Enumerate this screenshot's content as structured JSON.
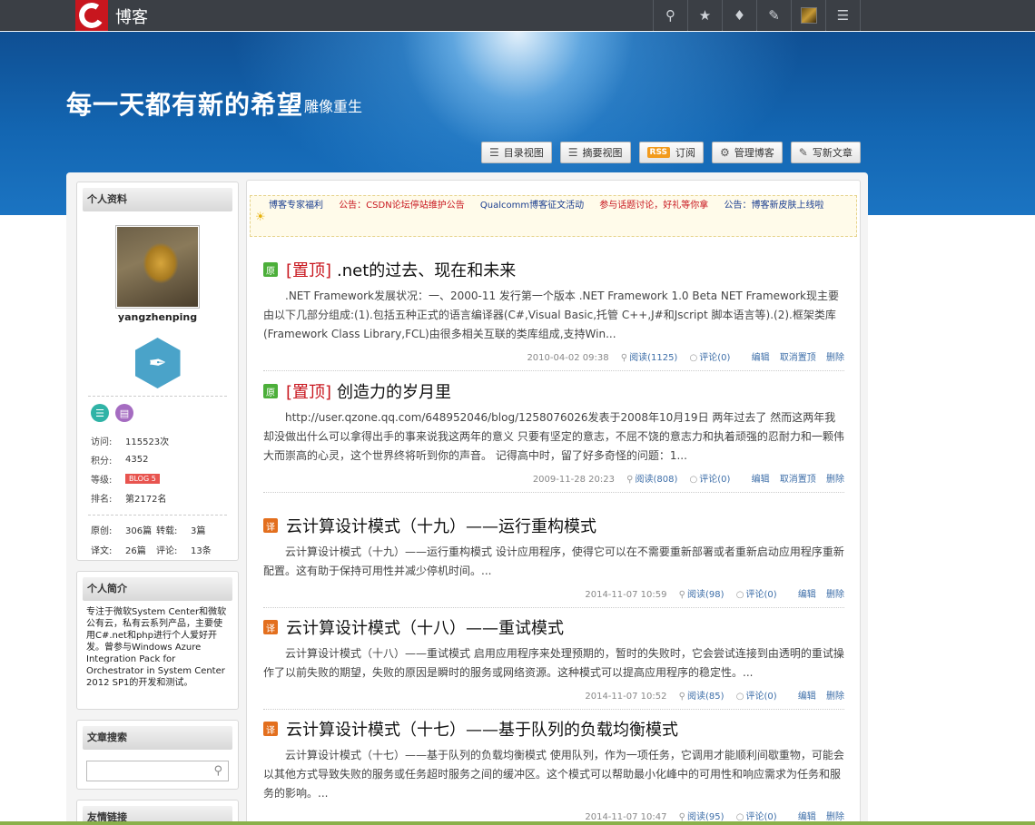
{
  "topbar": {
    "brand": "博客",
    "icons": [
      "search-icon",
      "star-icon",
      "bell-icon",
      "edit-icon",
      "avatar",
      "menu-icon"
    ]
  },
  "banner": {
    "title": "每一天都有新的希望",
    "subtitle": "雕像重生",
    "buttons": [
      {
        "label": "目录视图",
        "icon": "list-icon"
      },
      {
        "label": "摘要视图",
        "icon": "summary-icon"
      },
      {
        "label": "订阅",
        "icon": "rss-icon",
        "badge": "RSS"
      },
      {
        "label": "管理博客",
        "icon": "gear-icon"
      },
      {
        "label": "写新文章",
        "icon": "write-icon"
      }
    ]
  },
  "sidebar": {
    "profile_title": "个人资料",
    "username": "yangzhenping",
    "stats": [
      {
        "label": "访问:",
        "value": "115523次"
      },
      {
        "label": "积分:",
        "value": "4352"
      },
      {
        "label": "等级:",
        "value": "BLOG 5"
      },
      {
        "label": "排名:",
        "value": "第2172名"
      }
    ],
    "counts": [
      {
        "label": "原创:",
        "value": "306篇"
      },
      {
        "label": "转载:",
        "value": "3篇"
      },
      {
        "label": "译文:",
        "value": "26篇"
      },
      {
        "label": "评论:",
        "value": "13条"
      }
    ],
    "intro_title": "个人简介",
    "intro_text": "专注于微软System Center和微软公有云，私有云系列产品，主要使用C#.net和php进行个人爱好开发。曾参与Windows Azure Integration Pack for Orchestrator in System Center 2012 SP1的开发和测试。",
    "search_title": "文章搜索",
    "search_placeholder": "",
    "links_title": "友情链接"
  },
  "notices": [
    {
      "text": "博客专家福利",
      "color": "#1a3d8f"
    },
    {
      "text": "公告：CSDN论坛停站维护公告",
      "color": "#c8161e"
    },
    {
      "text": "Qualcomm博客征文活动",
      "color": "#1a3d8f"
    },
    {
      "text": "参与话题讨论，好礼等你拿",
      "color": "#c8161e"
    },
    {
      "text": "公告：博客新皮肤上线啦",
      "color": "#1a3d8f"
    }
  ],
  "posts": [
    {
      "tag": "原",
      "tag_color": "#4caf3a",
      "top": "[置顶]",
      "title": ".net的过去、现在和未来",
      "summary": ".NET Framework发展状况：一、2000-11  发行第一个版本 .NET Framework 1.0 Beta NET Framework现主要由以下几部分组成:(1).包括五种正式的语言编译器(C#,Visual Basic,托管 C++,J#和Jscript 脚本语言等).(2).框架类库(Framework Class Library,FCL)由很多相关互联的类库组成,支持Win...",
      "date": "2010-04-02 09:38",
      "reads": "阅读(1125)",
      "comments": "评论(0)",
      "actions": [
        "编辑",
        "取消置顶",
        "删除"
      ]
    },
    {
      "tag": "原",
      "tag_color": "#4caf3a",
      "top": "[置顶]",
      "title": "创造力的岁月里",
      "summary": "http://user.qzone.qq.com/648952046/blog/1258076026发表于2008年10月19日   两年过去了 然而这两年我却没做出什么可以拿得出手的事来说我这两年的意义 只要有坚定的意志，不屈不饶的意志力和执着顽强的忍耐力和一颗伟大而崇高的心灵，这个世界终将听到你的声音。 记得高中时，留了好多奇怪的问题：1...",
      "date": "2009-11-28 20:23",
      "reads": "阅读(808)",
      "comments": "评论(0)",
      "actions": [
        "编辑",
        "取消置顶",
        "删除"
      ]
    },
    {
      "tag": "译",
      "tag_color": "#e36f1e",
      "top": "",
      "title": "云计算设计模式（十九）——运行重构模式",
      "summary": "云计算设计模式（十九）——运行重构模式 设计应用程序，使得它可以在不需要重新部署或者重新启动应用程序重新配置。这有助于保持可用性并减少停机时间。...",
      "date": "2014-11-07 10:59",
      "reads": "阅读(98)",
      "comments": "评论(0)",
      "actions": [
        "编辑",
        "删除"
      ]
    },
    {
      "tag": "译",
      "tag_color": "#e36f1e",
      "top": "",
      "title": "云计算设计模式（十八）——重试模式",
      "summary": "云计算设计模式（十八）——重试模式 启用应用程序来处理预期的，暂时的失败时，它会尝试连接到由透明的重试操作了以前失败的期望，失败的原因是瞬时的服务或网络资源。这种模式可以提高应用程序的稳定性。...",
      "date": "2014-11-07 10:52",
      "reads": "阅读(85)",
      "comments": "评论(0)",
      "actions": [
        "编辑",
        "删除"
      ]
    },
    {
      "tag": "译",
      "tag_color": "#e36f1e",
      "top": "",
      "title": "云计算设计模式（十七）——基于队列的负载均衡模式",
      "summary": "云计算设计模式（十七）——基于队列的负载均衡模式 使用队列，作为一项任务，它调用才能顺利间歇重物，可能会以其他方式导致失败的服务或任务超时服务之间的缓冲区。这个模式可以帮助最小化峰中的可用性和响应需求为任务和服务的影响。...",
      "date": "2014-11-07 10:47",
      "reads": "阅读(95)",
      "comments": "评论(0)",
      "actions": [
        "编辑",
        "删除"
      ]
    }
  ]
}
